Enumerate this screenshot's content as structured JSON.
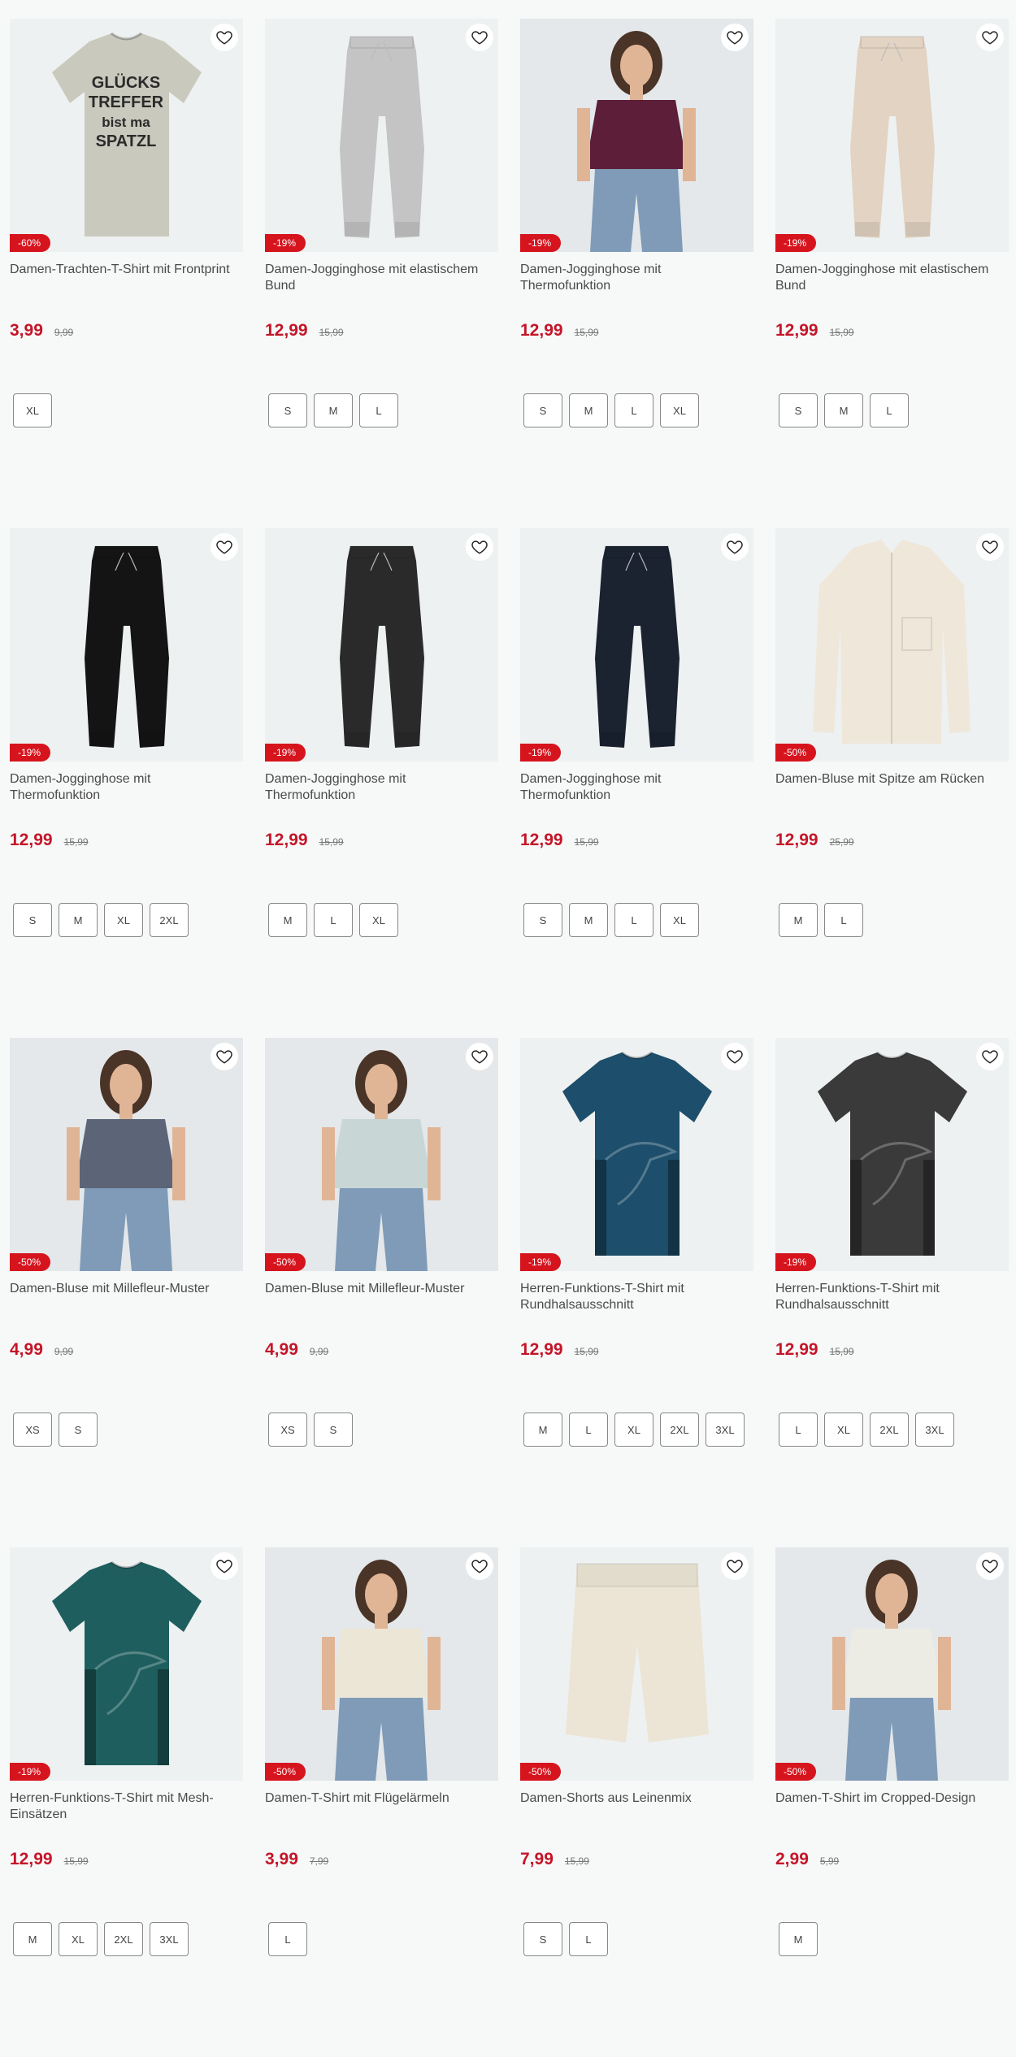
{
  "icons": {
    "wishlist": "heart-outline-icon"
  },
  "colors": {
    "price": "#c41528",
    "badge": "#d6141e",
    "background": "#f7f8f8"
  },
  "products": [
    {
      "title": "Damen-Trachten-T-Shirt mit Frontprint",
      "discount": "-60%",
      "price": "3,99",
      "old_price": "9,99",
      "sizes": [
        "XL"
      ],
      "image": "tshirt-print",
      "color": "#c9c9bd",
      "print_lines": [
        "GLÜCKS",
        "TREFFER",
        "bist ma",
        "SPATZL"
      ]
    },
    {
      "title": "Damen-Jogginghose mit elastischem Bund",
      "discount": "-19%",
      "price": "12,99",
      "old_price": "15,99",
      "sizes": [
        "S",
        "M",
        "L"
      ],
      "image": "pants",
      "color": "#c4c4c4"
    },
    {
      "title": "Damen-Jogginghose mit Thermofunktion",
      "discount": "-19%",
      "price": "12,99",
      "old_price": "15,99",
      "sizes": [
        "S",
        "M",
        "L",
        "XL"
      ],
      "image": "model-photo",
      "color": "#5c1e38"
    },
    {
      "title": "Damen-Jogginghose mit elastischem Bund",
      "discount": "-19%",
      "price": "12,99",
      "old_price": "15,99",
      "sizes": [
        "S",
        "M",
        "L"
      ],
      "image": "pants",
      "color": "#e2d3c3"
    },
    {
      "title": "Damen-Jogginghose mit Thermofunktion",
      "discount": "-19%",
      "price": "12,99",
      "old_price": "15,99",
      "sizes": [
        "S",
        "M",
        "XL",
        "2XL"
      ],
      "image": "pants",
      "color": "#141414"
    },
    {
      "title": "Damen-Jogginghose mit Thermofunktion",
      "discount": "-19%",
      "price": "12,99",
      "old_price": "15,99",
      "sizes": [
        "M",
        "L",
        "XL"
      ],
      "image": "pants",
      "color": "#2a2a2a"
    },
    {
      "title": "Damen-Jogginghose mit Thermofunktion",
      "discount": "-19%",
      "price": "12,99",
      "old_price": "15,99",
      "sizes": [
        "S",
        "M",
        "L",
        "XL"
      ],
      "image": "pants",
      "color": "#1b2230"
    },
    {
      "title": "Damen-Bluse mit Spitze am Rücken",
      "discount": "-50%",
      "price": "12,99",
      "old_price": "25,99",
      "sizes": [
        "M",
        "L"
      ],
      "image": "blouse",
      "color": "#efe7da"
    },
    {
      "title": "Damen-Bluse mit Millefleur-Muster",
      "discount": "-50%",
      "price": "4,99",
      "old_price": "9,99",
      "sizes": [
        "XS",
        "S"
      ],
      "image": "model-photo",
      "color": "#5b6577"
    },
    {
      "title": "Damen-Bluse mit Millefleur-Muster",
      "discount": "-50%",
      "price": "4,99",
      "old_price": "9,99",
      "sizes": [
        "XS",
        "S"
      ],
      "image": "model-photo",
      "color": "#c9d6d6"
    },
    {
      "title": "Herren-Funktions-T-Shirt mit Rundhalsausschnitt",
      "discount": "-19%",
      "price": "12,99",
      "old_price": "15,99",
      "sizes": [
        "M",
        "L",
        "XL",
        "2XL",
        "3XL"
      ],
      "image": "tshirt",
      "color": "#1d4e6b"
    },
    {
      "title": "Herren-Funktions-T-Shirt mit Rundhalsausschnitt",
      "discount": "-19%",
      "price": "12,99",
      "old_price": "15,99",
      "sizes": [
        "L",
        "XL",
        "2XL",
        "3XL"
      ],
      "image": "tshirt",
      "color": "#3a3a3a"
    },
    {
      "title": "Herren-Funktions-T-Shirt mit Mesh-Einsätzen",
      "discount": "-19%",
      "price": "12,99",
      "old_price": "15,99",
      "sizes": [
        "M",
        "XL",
        "2XL",
        "3XL"
      ],
      "image": "tshirt",
      "color": "#1f5e5e"
    },
    {
      "title": "Damen-T-Shirt mit Flügelärmeln",
      "discount": "-50%",
      "price": "3,99",
      "old_price": "7,99",
      "sizes": [
        "L"
      ],
      "image": "model-photo",
      "color": "#ece6d6"
    },
    {
      "title": "Damen-Shorts aus Leinenmix",
      "discount": "-50%",
      "price": "7,99",
      "old_price": "15,99",
      "sizes": [
        "S",
        "L"
      ],
      "image": "shorts",
      "color": "#ece5d6"
    },
    {
      "title": "Damen-T-Shirt im Cropped-Design",
      "discount": "-50%",
      "price": "2,99",
      "old_price": "5,99",
      "sizes": [
        "M"
      ],
      "image": "model-photo",
      "color": "#ecebe4"
    }
  ]
}
